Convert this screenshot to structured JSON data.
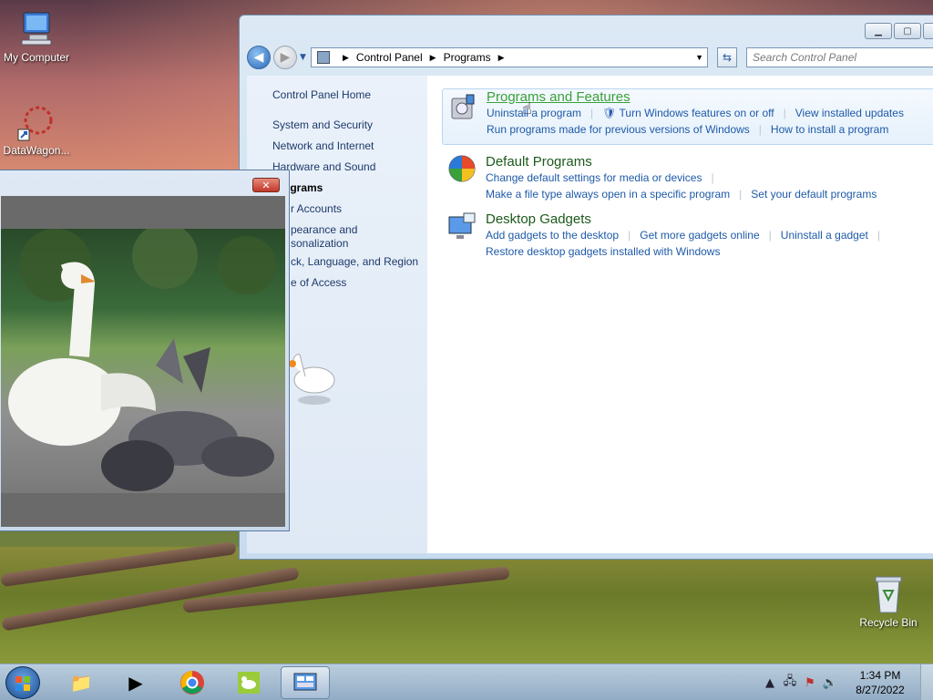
{
  "desktop": {
    "icons": [
      {
        "label": "My Computer"
      },
      {
        "label": "DataWagon..."
      },
      {
        "label": "Recycle Bin"
      }
    ]
  },
  "control_panel": {
    "breadcrumb": [
      "Control Panel",
      "Programs"
    ],
    "search_placeholder": "Search Control Panel",
    "left_nav": {
      "home": "Control Panel Home",
      "items": [
        "System and Security",
        "Network and Internet",
        "Hardware and Sound",
        "ograms",
        "r Accounts",
        "pearance and",
        "sonalization",
        "ck, Language, and Region",
        "e of Access"
      ]
    },
    "categories": [
      {
        "title": "Programs and Features",
        "links_row1": [
          "Uninstall a program",
          "Turn Windows features on or off",
          "View installed updates"
        ],
        "links_row2": [
          "Run programs made for previous versions of Windows",
          "How to install a program"
        ]
      },
      {
        "title": "Default Programs",
        "links_row1": [
          "Change default settings for media or devices"
        ],
        "links_row2": [
          "Make a file type always open in a specific program",
          "Set your default programs"
        ]
      },
      {
        "title": "Desktop Gadgets",
        "links_row1": [
          "Add gadgets to the desktop",
          "Get more gadgets online",
          "Uninstall a gadget"
        ],
        "links_row2": [
          "Restore desktop gadgets installed with Windows"
        ]
      }
    ]
  },
  "video_window": {
    "close_glyph": "✕"
  },
  "taskbar": {
    "time": "1:34 PM",
    "date": "8/27/2022"
  },
  "colors": {
    "link": "#1e5aa8",
    "category_title": "#1c5a1c",
    "hover_title": "#3aa13a"
  }
}
